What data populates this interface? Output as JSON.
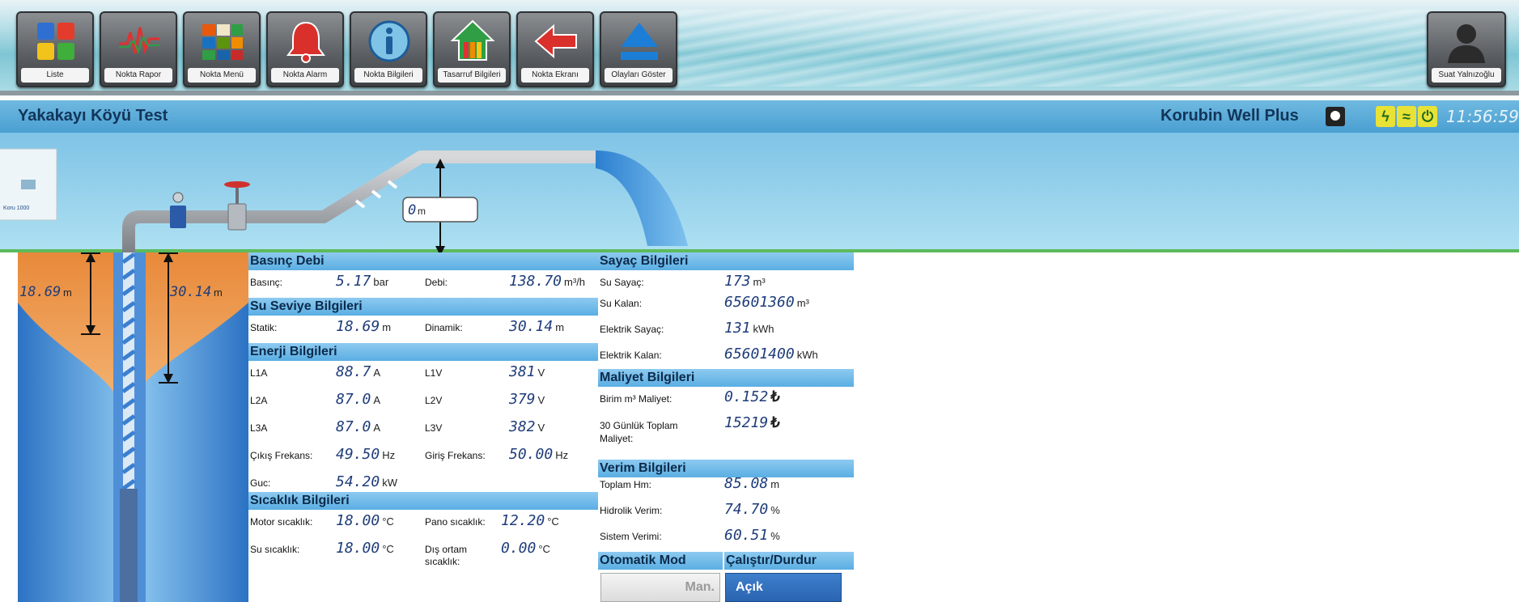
{
  "toolbar": {
    "buttons": [
      {
        "label": "Liste",
        "icon": "grid-colors-icon"
      },
      {
        "label": "Nokta Rapor",
        "icon": "waveform-icon"
      },
      {
        "label": "Nokta Menü",
        "icon": "menu-squares-icon"
      },
      {
        "label": "Nokta Alarm",
        "icon": "bell-icon"
      },
      {
        "label": "Nokta Bilgileri",
        "icon": "info-icon"
      },
      {
        "label": "Tasarruf Bilgileri",
        "icon": "house-icon"
      },
      {
        "label": "Nokta Ekranı",
        "icon": "back-arrow-icon"
      },
      {
        "label": "Olayları Göster",
        "icon": "eject-icon"
      }
    ],
    "user": {
      "name": "Suat Yalnızoğlu",
      "icon": "user-avatar-icon"
    }
  },
  "titlebar": {
    "site": "Yakakayı Köyü Test",
    "product": "Korubin Well Plus",
    "time": "11:56:59",
    "status_icons": [
      "clock-icon",
      "power-bolt-icon",
      "wifi-icon",
      "power-icon"
    ]
  },
  "scene": {
    "panel_label": "Koru 1000",
    "head_height": "0",
    "head_unit": "m",
    "static_level": "18.69",
    "dynamic_level": "30.14",
    "level_unit": "m"
  },
  "basinc_debi": {
    "title": "Basınç Debi",
    "basinc_label": "Basınç:",
    "basinc_value": "5.17",
    "basinc_unit": "bar",
    "debi_label": "Debi:",
    "debi_value": "138.70",
    "debi_unit": "m³/h"
  },
  "su_seviye": {
    "title": "Su Seviye Bilgileri",
    "statik_label": "Statik:",
    "statik_value": "18.69",
    "statik_unit": "m",
    "dinamik_label": "Dinamik:",
    "dinamik_value": "30.14",
    "dinamik_unit": "m"
  },
  "enerji": {
    "title": "Enerji Bilgileri",
    "rows": [
      {
        "l1": "L1A",
        "v1": "88.7",
        "u1": "A",
        "l2": "L1V",
        "v2": "381",
        "u2": "V"
      },
      {
        "l1": "L2A",
        "v1": "87.0",
        "u1": "A",
        "l2": "L2V",
        "v2": "379",
        "u2": "V"
      },
      {
        "l1": "L3A",
        "v1": "87.0",
        "u1": "A",
        "l2": "L3V",
        "v2": "382",
        "u2": "V"
      },
      {
        "l1": "Çıkış Frekans:",
        "v1": "49.50",
        "u1": "Hz",
        "l2": "Giriş Frekans:",
        "v2": "50.00",
        "u2": "Hz"
      }
    ],
    "guc_label": "Guc:",
    "guc_value": "54.20",
    "guc_unit": "kW"
  },
  "sicaklik": {
    "title": "Sıcaklık Bilgileri",
    "motor_label": "Motor sıcaklık:",
    "motor_value": "18.00",
    "motor_unit": "°C",
    "pano_label": "Pano sıcaklık:",
    "pano_value": "12.20",
    "pano_unit": "°C",
    "su_label": "Su sıcaklık:",
    "su_value": "18.00",
    "su_unit": "°C",
    "dis_label": "Dış ortam sıcaklık:",
    "dis_value": "0.00",
    "dis_unit": "°C"
  },
  "sayac": {
    "title": "Sayaç Bilgileri",
    "rows": [
      {
        "label": "Su Sayaç:",
        "value": "173",
        "unit": "m³"
      },
      {
        "label": "Su Kalan:",
        "value": "65601360",
        "unit": "m³"
      },
      {
        "label": "Elektrik Sayaç:",
        "value": "131",
        "unit": "kWh"
      },
      {
        "label": "Elektrik Kalan:",
        "value": "65601400",
        "unit": "kWh"
      }
    ]
  },
  "maliyet": {
    "title": "Maliyet Bilgileri",
    "birim_label": "Birim m³ Maliyet:",
    "birim_value": "0.152",
    "birim_unit": "₺",
    "toplam_label": "30 Günlük Toplam Maliyet:",
    "toplam_value": "15219",
    "toplam_unit": "₺"
  },
  "verim": {
    "title": "Verim Bilgileri",
    "rows": [
      {
        "label": "Toplam Hm:",
        "value": "85.08",
        "unit": "m"
      },
      {
        "label": "Hidrolik Verim:",
        "value": "74.70",
        "unit": "%"
      },
      {
        "label": "Sistem Verimi:",
        "value": "60.51",
        "unit": "%"
      }
    ]
  },
  "controls": {
    "mode_title": "Otomatik Mod",
    "run_title": "Çalıştır/Durdur",
    "man_label": "Man.",
    "acik_label": "Açık"
  },
  "colors": {
    "header_blue": "#5aaee3",
    "value_blue": "#1f3d7a",
    "water_blue": "#3d8fd6",
    "soil_orange": "#e08c3c",
    "ground_green": "#5cba5c"
  }
}
